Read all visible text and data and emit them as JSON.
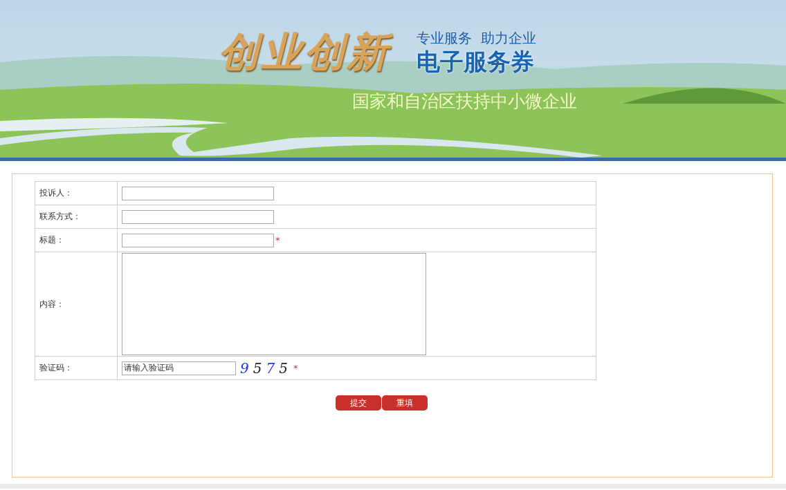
{
  "banner": {
    "slogan": "创业创新",
    "tagline": "专业服务  助力企业",
    "title": "电子服务券",
    "subtitle": "国家和自治区扶持中小微企业"
  },
  "form": {
    "fields": [
      {
        "label": "投诉人：",
        "kind": "text",
        "required": false
      },
      {
        "label": "联系方式：",
        "kind": "text",
        "required": false
      },
      {
        "label": "标题：",
        "kind": "text",
        "required": true,
        "required_mark": "*"
      },
      {
        "label": "内容：",
        "kind": "textarea",
        "required": false
      },
      {
        "label": "验证码：",
        "kind": "captcha",
        "required": true,
        "required_mark": "*",
        "value": "请输入验证码",
        "captcha": "9575"
      }
    ],
    "buttons": [
      "提交",
      "重填"
    ]
  }
}
